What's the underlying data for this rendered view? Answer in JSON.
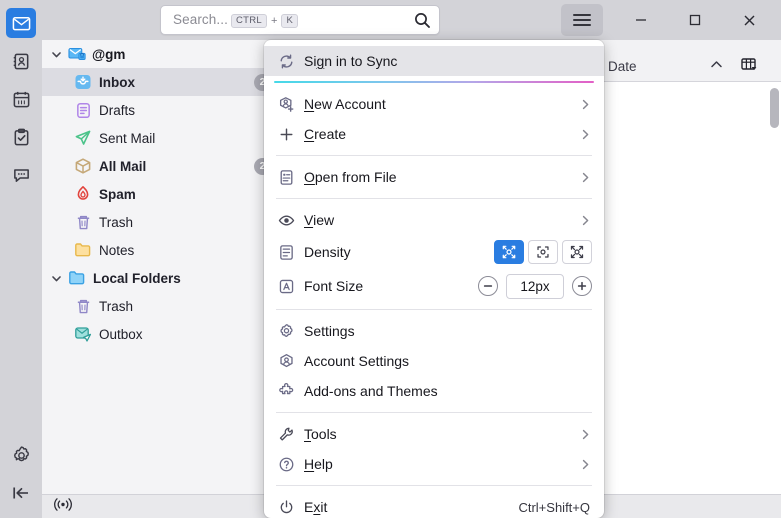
{
  "window": {
    "controls": [
      {
        "name": "minimize",
        "glyph": "minimize-icon"
      },
      {
        "name": "maximize",
        "glyph": "maximize-icon"
      },
      {
        "name": "close",
        "glyph": "close-icon"
      }
    ]
  },
  "search": {
    "placeholder_text": "Search...",
    "kbd_primary": "CTRL",
    "kbd_plus": "+",
    "kbd_secondary": "K",
    "icon": "search-icon"
  },
  "appmenu_button": {
    "icon": "hamburger-icon"
  },
  "spaces": {
    "items": [
      {
        "name": "mail",
        "icon": "envelope-icon",
        "selected": true
      },
      {
        "name": "address-book",
        "icon": "address-book-icon",
        "selected": false
      },
      {
        "name": "calendar",
        "icon": "calendar-icon",
        "selected": false
      },
      {
        "name": "tasks",
        "icon": "tasks-clipboard-icon",
        "selected": false
      },
      {
        "name": "chat",
        "icon": "chat-bubble-icon",
        "selected": false
      }
    ],
    "bottom": [
      {
        "name": "settings",
        "icon": "gear-icon"
      },
      {
        "name": "collapse-spaces",
        "icon": "collapse-left-icon"
      }
    ]
  },
  "folder_pane": {
    "account": {
      "label": "@gm",
      "icon": "secure-mail-icon",
      "twisty": "chevron-down-icon"
    },
    "folders": [
      {
        "label": "Inbox",
        "icon": "inbox-icon",
        "bold": true,
        "selected": true,
        "badge": "2",
        "indent": 1
      },
      {
        "label": "Drafts",
        "icon": "drafts-icon",
        "bold": false,
        "selected": false,
        "badge": "",
        "indent": 1
      },
      {
        "label": "Sent Mail",
        "icon": "sent-icon",
        "bold": false,
        "selected": false,
        "badge": "",
        "indent": 1
      },
      {
        "label": "All Mail",
        "icon": "archive-icon",
        "bold": true,
        "selected": false,
        "badge": "2",
        "indent": 1
      },
      {
        "label": "Spam",
        "icon": "spam-flame-icon",
        "bold": true,
        "selected": false,
        "badge": "",
        "indent": 1
      },
      {
        "label": "Trash",
        "icon": "trash-icon",
        "bold": false,
        "selected": false,
        "badge": "",
        "indent": 1
      },
      {
        "label": "Notes",
        "icon": "folder-icon",
        "bold": false,
        "selected": false,
        "badge": "",
        "indent": 1
      }
    ],
    "local": {
      "label": "Local Folders",
      "icon": "local-folder-icon",
      "twisty": "chevron-down-icon"
    },
    "local_folders": [
      {
        "label": "Trash",
        "icon": "trash-icon",
        "bold": false,
        "selected": false,
        "badge": "",
        "indent": 1
      },
      {
        "label": "Outbox",
        "icon": "outbox-icon",
        "bold": false,
        "selected": false,
        "badge": "",
        "indent": 1
      }
    ]
  },
  "message_list": {
    "columns": [
      {
        "label": "Date",
        "sort": "ascending"
      }
    ],
    "sort_icon": "chevron-up-icon",
    "column_picker_icon": "column-picker-icon"
  },
  "statusbar": {
    "icon": "connectivity-icon"
  },
  "appmenu": {
    "sign_in": {
      "label": "Sign in to Sync",
      "accel": "g",
      "icon": "sync-icon",
      "highlighted": true
    },
    "groups": [
      {
        "items": [
          {
            "label": "New Account",
            "accel": "N",
            "icon": "new-account-icon",
            "submenu": true
          },
          {
            "label": "Create",
            "accel": "C",
            "icon": "plus-icon",
            "submenu": true
          }
        ]
      },
      {
        "items": [
          {
            "label": "Open from File",
            "accel": "O",
            "icon": "open-file-icon",
            "submenu": true
          }
        ]
      },
      {
        "items": [
          {
            "label": "View",
            "accel": "V",
            "icon": "eye-icon",
            "submenu": true
          }
        ]
      },
      {
        "items": [
          {
            "label": "Settings",
            "accel": "",
            "icon": "gear-icon",
            "submenu": false
          },
          {
            "label": "Account Settings",
            "accel": "",
            "icon": "account-icon",
            "submenu": false
          },
          {
            "label": "Add-ons and Themes",
            "accel": "",
            "icon": "puzzle-icon",
            "submenu": false
          }
        ]
      },
      {
        "items": [
          {
            "label": "Tools",
            "accel": "T",
            "icon": "wrench-icon",
            "submenu": true
          },
          {
            "label": "Help",
            "accel": "H",
            "icon": "help-circle-icon",
            "submenu": true
          }
        ]
      },
      {
        "items": [
          {
            "label": "Exit",
            "accel": "x",
            "icon": "power-icon",
            "submenu": false,
            "shortcut": "Ctrl+Shift+Q"
          }
        ]
      }
    ],
    "density": {
      "label": "Density",
      "icon": "density-icon",
      "options": [
        {
          "name": "compact",
          "selected": true
        },
        {
          "name": "default",
          "selected": false
        },
        {
          "name": "relaxed",
          "selected": false
        }
      ]
    },
    "font_size": {
      "label": "Font Size",
      "icon": "font-size-icon",
      "decrease": "minus-icon",
      "increase": "plus-icon",
      "value": "12px"
    }
  },
  "colors": {
    "accent_blue": "#2a7de1",
    "chrome": "#d3d3d8",
    "pane": "#f4f4f6",
    "gradient_start": "#46d9e8",
    "gradient_end": "#e35fc6"
  }
}
